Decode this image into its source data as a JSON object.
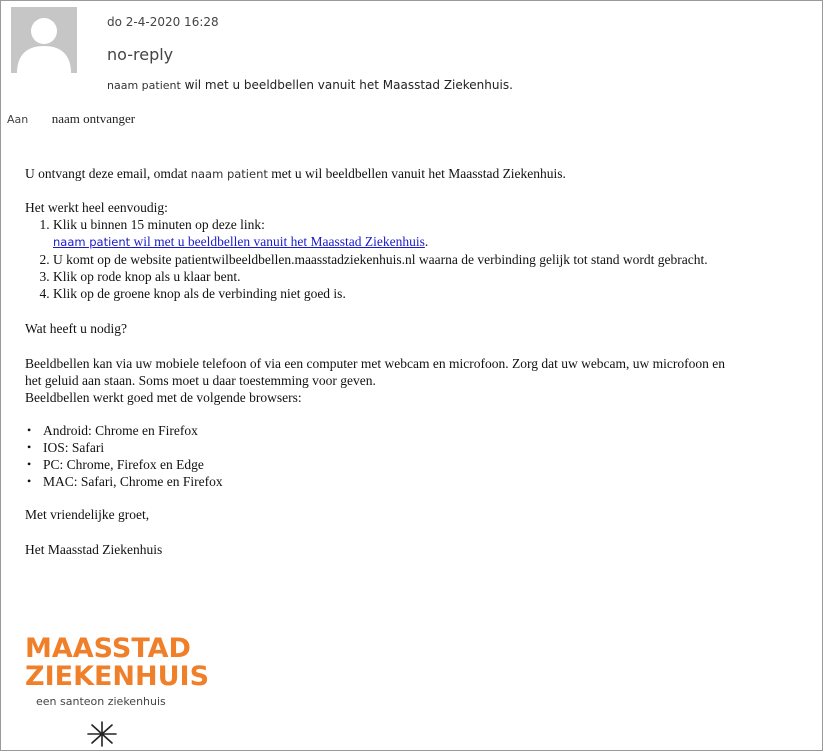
{
  "header": {
    "sent_date": "do 2-4-2020 16:28",
    "sender": "no-reply",
    "subject_name": "naam patient",
    "subject_rest": " wil met u beeldbellen vanuit het Maasstad Ziekenhuis.",
    "to_label": "Aan",
    "to_name": "naam ontvanger"
  },
  "body": {
    "intro_before": "U ontvangt deze email, omdat ",
    "intro_name": "naam patient",
    "intro_after": " met u wil beeldbellen vanuit het Maasstad Ziekenhuis.",
    "how_title": "Het werkt heel eenvoudig:",
    "step1": "Klik u binnen 15 minuten op deze link:",
    "link_name": "naam patient",
    "link_rest": " wil met u beeldbellen vanuit het Maasstad Ziekenhuis",
    "link_dot": ".",
    "step2": "U komt op de website patientwilbeeldbellen.maasstadziekenhuis.nl waarna de verbinding gelijk tot stand wordt gebracht.",
    "step3": "Klik op rode knop als u klaar bent.",
    "step4": "Klik op de groene knop als de verbinding niet goed is.",
    "need_title": "Wat heeft u nodig?",
    "webcam_line1": "Beeldbellen kan via uw mobiele telefoon of via een computer met webcam en microfoon. Zorg dat uw webcam, uw microfoon en",
    "webcam_line2": "het geluid aan staan. Soms moet u daar toestemming voor geven.",
    "browsers_intro": "Beeldbellen werkt goed met de volgende browsers:",
    "browsers": [
      "Android: Chrome en Firefox",
      "IOS: Safari",
      "PC: Chrome, Firefox en Edge",
      "MAC: Safari, Chrome en Firefox"
    ],
    "regards": "Met vriendelijke groet,",
    "org": "Het Maasstad Ziekenhuis"
  },
  "logo": {
    "line1": "MAASSTAD",
    "line2": "ZIEKENHUIS",
    "tagline": "een santeon ziekenhuis",
    "color": "#f07f2a"
  },
  "icons": {
    "avatar": "person-placeholder-icon",
    "logo_mark": "asterisk-star-icon"
  }
}
